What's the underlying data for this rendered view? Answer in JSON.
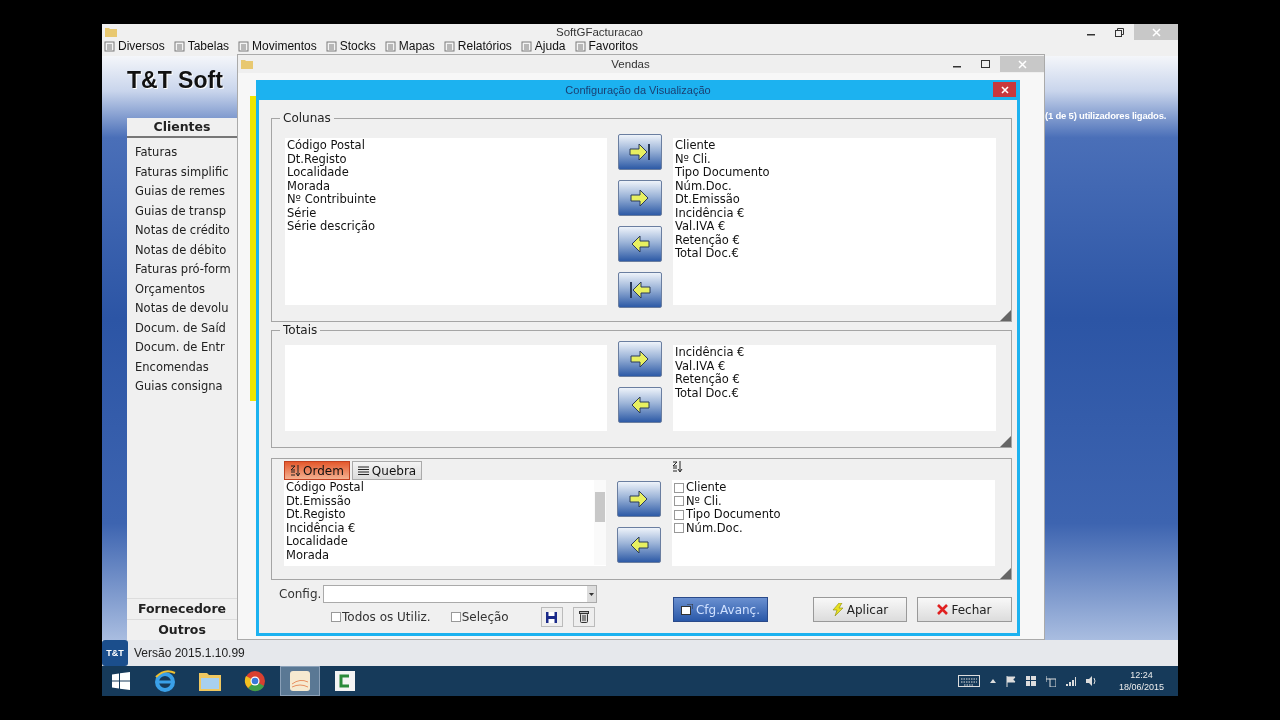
{
  "app_window": {
    "title": "SoftGFacturacao"
  },
  "menu": [
    {
      "label": "Diversos"
    },
    {
      "label": "Tabelas"
    },
    {
      "label": "Movimentos"
    },
    {
      "label": "Stocks"
    },
    {
      "label": "Mapas"
    },
    {
      "label": "Relatórios"
    },
    {
      "label": "Ajuda"
    },
    {
      "label": "Favoritos"
    }
  ],
  "brand": "T&T Soft",
  "sidebar": {
    "header": "Clientes",
    "items": [
      "Faturas",
      "Faturas simplific",
      "Guias de remes",
      "Guias de transp",
      "Notas de crédito",
      "Notas de débito",
      "Faturas pró-form",
      "Orçamentos",
      "Notas de devolu",
      "Docum. de Saíd",
      "Docum. de Entr",
      "Encomendas",
      "Guias consigna"
    ],
    "sections": [
      "Fornecedore",
      "Outros"
    ]
  },
  "users_status": "(1 de 5) utilizadores ligados.",
  "status_bar": {
    "badge": "T&T",
    "version": "Versão 2015.1.10.99"
  },
  "vendas_window": {
    "title": "Vendas"
  },
  "dialog": {
    "title": "Configuração da Visualização",
    "columns": {
      "title": "Colunas",
      "available": [
        "Código Postal",
        "Dt.Registo",
        "Localidade",
        "Morada",
        "Nº Contribuinte",
        "Série",
        "Série descrição"
      ],
      "selected": [
        "Cliente",
        "Nº Cli.",
        "Tipo Documento",
        "Núm.Doc.",
        "Dt.Emissão",
        "Incidência €",
        "Val.IVA €",
        "Retenção €",
        "Total Doc.€"
      ]
    },
    "totals": {
      "title": "Totais",
      "selected": [
        "Incidência €",
        "Val.IVA €",
        "Retenção €",
        "Total Doc.€"
      ]
    },
    "order": {
      "tabs": [
        {
          "label": "Ordem",
          "kind": "sort",
          "selected": true
        },
        {
          "label": "Quebra",
          "kind": "list",
          "selected": false
        }
      ],
      "available": [
        "Código Postal",
        "Dt.Emissão",
        "Dt.Registo",
        "Incidência €",
        "Localidade",
        "Morada"
      ],
      "selected": [
        {
          "label": "Cliente",
          "checked": false
        },
        {
          "label": "Nº Cli.",
          "checked": false
        },
        {
          "label": "Tipo Documento",
          "checked": false
        },
        {
          "label": "Núm.Doc.",
          "checked": false
        }
      ]
    },
    "config": {
      "label": "Config.",
      "options": [
        {
          "label": "Todos os Utiliz.",
          "checked": false
        },
        {
          "label": "Seleção",
          "checked": false
        }
      ]
    },
    "buttons": [
      {
        "label": "Cfg.Avanç.",
        "kind": "advanced"
      },
      {
        "label": "Aplicar",
        "kind": "apply"
      },
      {
        "label": "Fechar",
        "kind": "close"
      }
    ]
  },
  "taskbar": {
    "apps": [
      {
        "kind": "browser",
        "selected": false
      },
      {
        "kind": "folder",
        "selected": false
      },
      {
        "kind": "chrome",
        "selected": false
      },
      {
        "kind": "notes",
        "selected": true
      },
      {
        "kind": "c-app",
        "selected": false
      }
    ],
    "time": "12:24",
    "date": "18/06/2015"
  }
}
